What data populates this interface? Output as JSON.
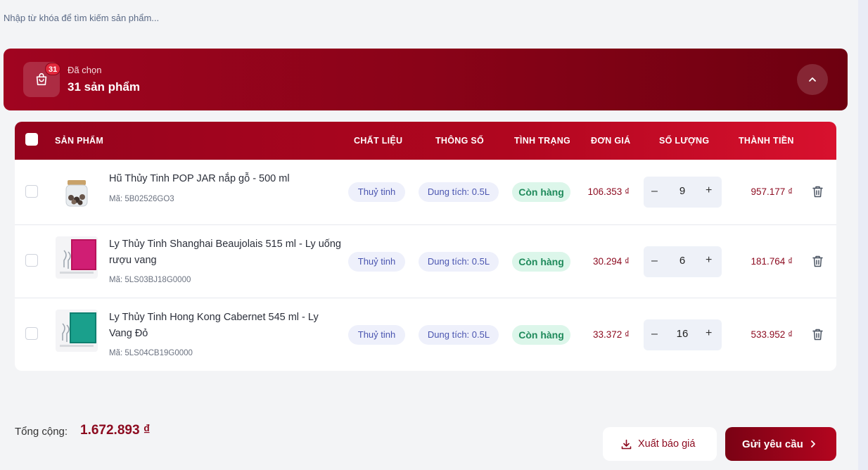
{
  "search": {
    "placeholder": "Nhập từ khóa để tìm kiếm sản phẩm..."
  },
  "header": {
    "badge_count": "31",
    "selected_label": "Đã chọn",
    "selected_count": "31 sản phẩm",
    "icons": {
      "cart": "shopping-bag-icon",
      "collapse": "chevron-up-icon"
    }
  },
  "table": {
    "columns": {
      "product": "SẢN PHẨM",
      "material": "CHẤT LIỆU",
      "spec": "THÔNG SỐ",
      "status": "TÌNH TRẠNG",
      "unit_price": "ĐƠN GIÁ",
      "quantity": "SỐ LƯỢNG",
      "line_total": "THÀNH TIỀN"
    },
    "rows": [
      {
        "name": "Hũ Thủy Tinh POP JAR nắp gỗ - 500 ml",
        "code": "Mã: 5B02526GO3",
        "material": "Thuỷ tinh",
        "spec": "Dung tích: 0.5L",
        "status": "Còn hàng",
        "unit_price": "106.353 ₫",
        "qty": "9",
        "line_total": "957.177 ₫"
      },
      {
        "name": "Ly Thủy Tinh Shanghai Beaujolais 515 ml - Ly uống rượu vang",
        "code": "Mã: 5LS03BJ18G0000",
        "material": "Thuỷ tinh",
        "spec": "Dung tích: 0.5L",
        "status": "Còn hàng",
        "unit_price": "30.294 ₫",
        "qty": "6",
        "line_total": "181.764 ₫"
      },
      {
        "name": "Ly Thủy Tinh Hong Kong Cabernet 545 ml - Ly Vang Đỏ",
        "code": "Mã: 5LS04CB19G0000",
        "material": "Thuỷ tinh",
        "spec": "Dung tích: 0.5L",
        "status": "Còn hàng",
        "unit_price": "33.372 ₫",
        "qty": "16",
        "line_total": "533.952 ₫"
      }
    ],
    "stepper": {
      "minus": "–",
      "plus": "+"
    }
  },
  "footer": {
    "total_label": "Tổng cộng:",
    "total_value": "1.672.893 ₫",
    "export_label": "Xuất báo giá",
    "send_label": "Gửi yêu cầu"
  },
  "colors": {
    "brand": "#8c0a1f",
    "header_gradient_start": "#a00420",
    "header_gradient_end": "#6e0010",
    "status_bg": "#dcf6ea",
    "status_text": "#1f8a5b",
    "chip_bg": "#eef0fb",
    "chip_text": "#4a55b0"
  }
}
